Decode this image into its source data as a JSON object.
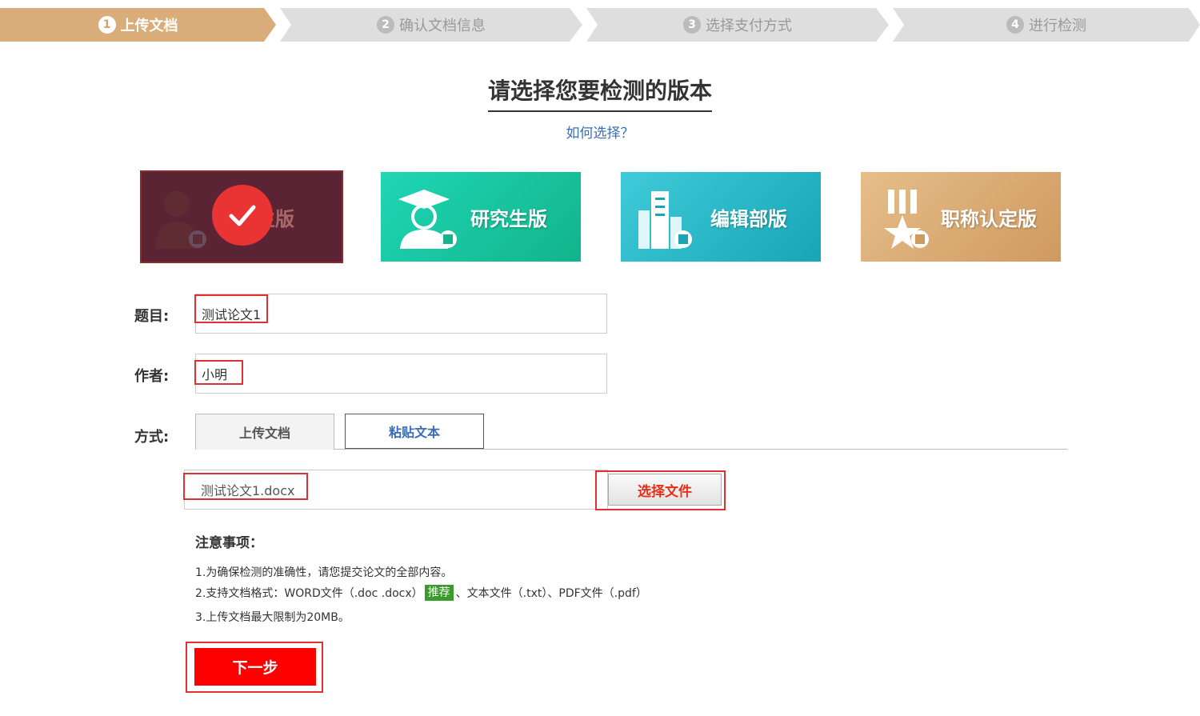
{
  "steps": [
    {
      "num": "1",
      "label": "上传文档"
    },
    {
      "num": "2",
      "label": "确认文档信息"
    },
    {
      "num": "3",
      "label": "选择支付方式"
    },
    {
      "num": "4",
      "label": "进行检测"
    }
  ],
  "active_step": 1,
  "title": "请选择您要检测的版本",
  "how_to_choose": "如何选择？",
  "versions": [
    {
      "label": "学生版"
    },
    {
      "label": "研究生版"
    },
    {
      "label": "编辑部版"
    },
    {
      "label": "职称认定版"
    }
  ],
  "form": {
    "title_label": "题目:",
    "title_value": "测试论文1",
    "author_label": "作者:",
    "author_value": "小明",
    "method_label": "方式:"
  },
  "tabs": [
    {
      "label": "上传文档"
    },
    {
      "label": "粘贴文本"
    }
  ],
  "file": {
    "name": "测试论文1.docx",
    "choose_label": "选择文件"
  },
  "notes": {
    "title": "注意事项：",
    "line1": "1.为确保检测的准确性，请您提交论文的全部内容。",
    "line2_pre": "2.支持文档格式：WORD文件（.doc .docx）",
    "line2_tag": "推荐",
    "line2_post": "、文本文件（.txt）、PDF文件（.pdf）",
    "line3": "3.上传文档最大限制为20MB。"
  },
  "next_label": "下一步",
  "colors": {
    "step_active": "#d9ad7a",
    "step_inactive": "#dedede",
    "highlight": "#e03030",
    "next_button": "#ff0000",
    "link": "#3b6cb7"
  }
}
